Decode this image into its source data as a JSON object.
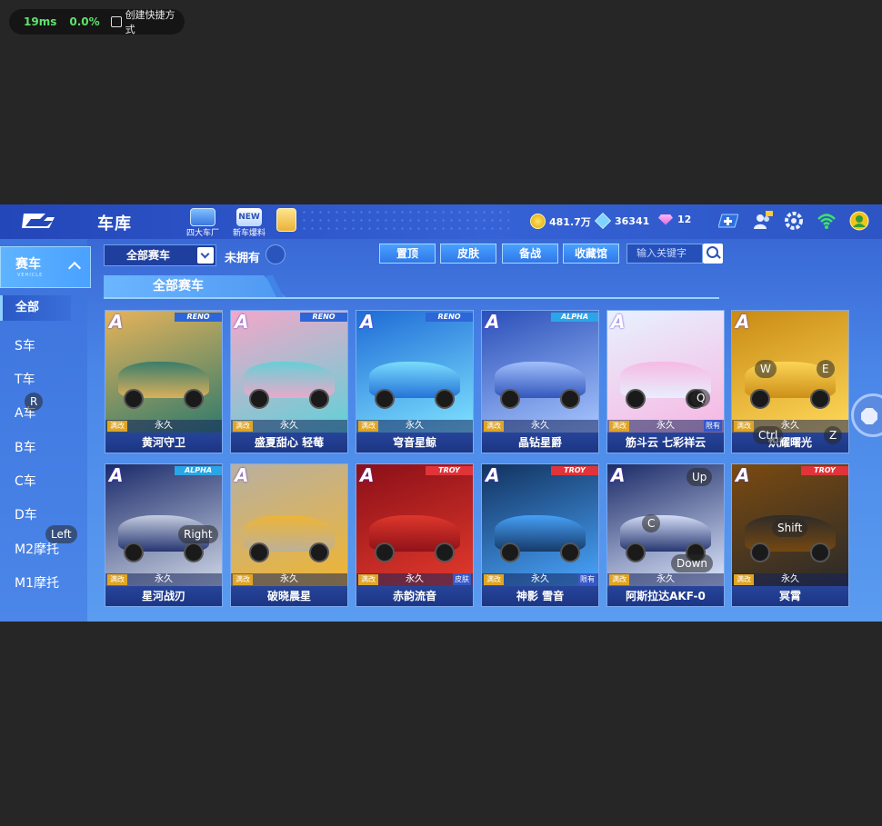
{
  "overlay": {
    "latency": "19ms",
    "loss": "0.0%",
    "shortcut_label": "创建快捷方式"
  },
  "header": {
    "title": "车库",
    "icons": [
      {
        "label": "四大车厂",
        "icon": "car-factory-icon"
      },
      {
        "label": "新车爆料",
        "icon": "new-car-icon"
      },
      {
        "label": "",
        "icon": "gift-icon"
      }
    ],
    "currency": {
      "coins": "481.7万",
      "gems": "36341",
      "diamonds": "12"
    },
    "right_icons": [
      "add-icon",
      "friends-icon",
      "settings-icon",
      "wifi-icon",
      "avatar-icon"
    ]
  },
  "sidebar": {
    "category": {
      "title": "赛车",
      "subtitle": "VEHICLE"
    },
    "items": [
      "全部",
      "S车",
      "T车",
      "A车",
      "B车",
      "C车",
      "D车",
      "M2摩托",
      "M1摩托"
    ],
    "selected_index": 0
  },
  "filter": {
    "value": "全部赛车",
    "unowned_label": "未拥有"
  },
  "tabs": [
    "置顶",
    "皮肤",
    "备战",
    "收藏馆"
  ],
  "search": {
    "placeholder": "输入关键字"
  },
  "section_title": "全部赛车",
  "cards": [
    {
      "name": "黄河守卫",
      "grade": "A",
      "brand": "RENO",
      "mod": "满改",
      "duration": "永久",
      "badge": ""
    },
    {
      "name": "盛夏甜心 轻莓",
      "grade": "A",
      "brand": "RENO",
      "mod": "满改",
      "duration": "永久",
      "badge": ""
    },
    {
      "name": "穹音星鲸",
      "grade": "A",
      "brand": "RENO",
      "mod": "满改",
      "duration": "永久",
      "badge": ""
    },
    {
      "name": "晶钻星爵",
      "grade": "A",
      "brand": "ALPHA",
      "mod": "满改",
      "duration": "永久",
      "badge": ""
    },
    {
      "name": "筋斗云 七彩祥云",
      "grade": "A",
      "brand": "",
      "mod": "满改",
      "duration": "永久",
      "badge": "限有"
    },
    {
      "name": "炽耀曙光",
      "grade": "A",
      "brand": "",
      "mod": "满改",
      "duration": "永久",
      "badge": ""
    },
    {
      "name": "星河战刃",
      "grade": "A",
      "brand": "ALPHA",
      "mod": "满改",
      "duration": "永久",
      "badge": ""
    },
    {
      "name": "破晓晨星",
      "grade": "A",
      "brand": "",
      "mod": "满改",
      "duration": "永久",
      "badge": ""
    },
    {
      "name": "赤韵流音",
      "grade": "A",
      "brand": "TROY",
      "mod": "满改",
      "duration": "永久",
      "badge": "皮肤"
    },
    {
      "name": "神影 雪音",
      "grade": "A",
      "brand": "TROY",
      "mod": "满改",
      "duration": "永久",
      "badge": "限有"
    },
    {
      "name": "阿斯拉达AKF-0",
      "grade": "A",
      "brand": "",
      "mod": "满改",
      "duration": "永久",
      "badge": ""
    },
    {
      "name": "冥霄",
      "grade": "A",
      "brand": "TROY",
      "mod": "满改",
      "duration": "永久",
      "badge": ""
    }
  ],
  "card_colors": [
    [
      "#e6b35a",
      "#2f7a6c"
    ],
    [
      "#f3a7c9",
      "#5fd1d6"
    ],
    [
      "#1e6bd6",
      "#7fe3ff"
    ],
    [
      "#2a4fb8",
      "#a8c6ff"
    ],
    [
      "#e7f2ff",
      "#f7b6e2"
    ],
    [
      "#c98a14",
      "#ffd95a"
    ],
    [
      "#1a2a6a",
      "#cfd7e6"
    ],
    [
      "#b9b0a0",
      "#f0b531"
    ],
    [
      "#8a0f18",
      "#e33a2c"
    ],
    [
      "#12325e",
      "#4aa6ff"
    ],
    [
      "#1a2a66",
      "#dfe8ff"
    ],
    [
      "#7a4a10",
      "#2a2a2a"
    ]
  ],
  "key_overlays": [
    "R",
    "Left",
    "Right",
    "Q",
    "W",
    "E",
    "Ctrl",
    "Z",
    "Up",
    "C",
    "Down",
    "Shift"
  ]
}
